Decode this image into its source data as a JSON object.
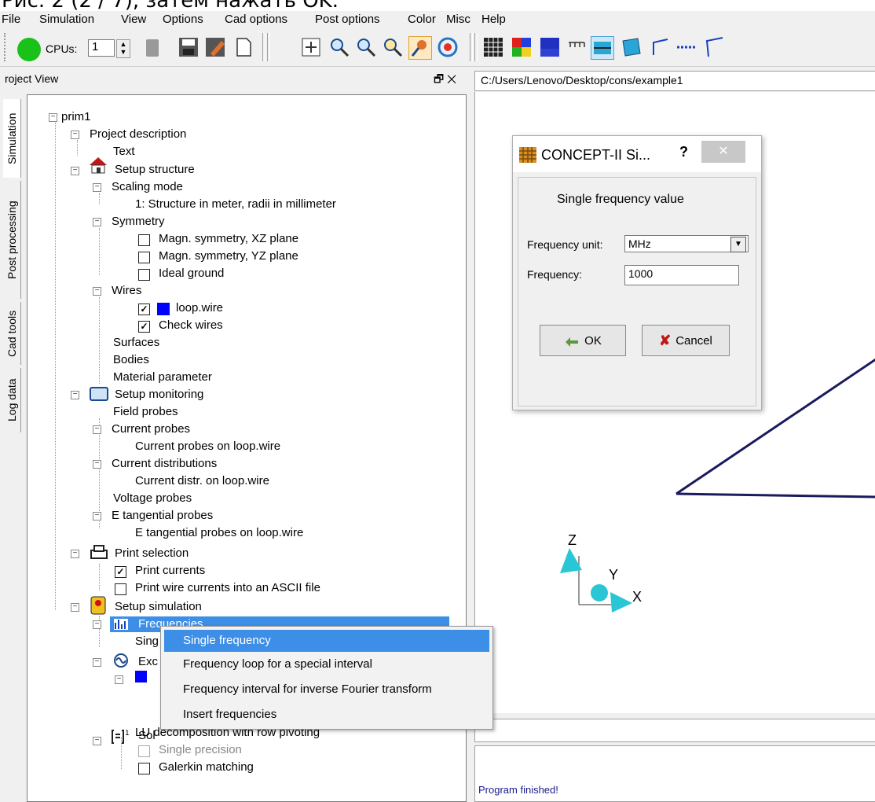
{
  "banner": {
    "text": "Рис. 2 (2 / 7), затем нажать OK."
  },
  "menubar": {
    "items": [
      "File",
      "Simulation",
      "View",
      "Options",
      "Cad options",
      "Post options",
      "Color",
      "Misc",
      "Help"
    ]
  },
  "toolbar": {
    "cpus_label": "CPUs:",
    "cpus_value": "1"
  },
  "project_view": {
    "title": "roject View",
    "pin": "🗗 ✕"
  },
  "side_tabs": [
    "Simulation",
    "Post processing",
    "Cad tools",
    "Log data"
  ],
  "tree": {
    "root": "prim1",
    "project_description": "Project description",
    "text": "Text",
    "setup_structure": "Setup structure",
    "scaling_mode": "Scaling mode",
    "scaling_value": "1: Structure in meter, radii in millimeter",
    "symmetry": "Symmetry",
    "sym_xz": "Magn. symmetry, XZ plane",
    "sym_yz": "Magn. symmetry, YZ plane",
    "ideal_ground": "Ideal ground",
    "wires": "Wires",
    "loop_wire": "loop.wire",
    "check_wires": "Check wires",
    "surfaces": "Surfaces",
    "bodies": "Bodies",
    "material": "Material parameter",
    "setup_monitoring": "Setup monitoring",
    "field_probes": "Field probes",
    "current_probes": "Current probes",
    "current_probes_loop": "Current probes on loop.wire",
    "current_distributions": "Current distributions",
    "current_distr_loop": "Current distr. on loop.wire",
    "voltage_probes": "Voltage probes",
    "e_tangential": "E tangential probes",
    "e_tangential_loop": "E tangential probes on loop.wire",
    "print_selection": "Print selection",
    "print_currents": "Print currents",
    "print_ascii": "Print wire currents into an ASCII file",
    "setup_simulation": "Setup simulation",
    "frequencies": "Frequencies",
    "single_partial": "Sing",
    "exc_partial": "Exc",
    "solver_partial": "Sol",
    "lu": "LU decomposition with row pivoting",
    "single_precision": "Single precision",
    "galerkin": "Galerkin matching"
  },
  "path": "C:/Users/Lenovo/Desktop/cons/example1",
  "dialog": {
    "title": "CONCEPT-II Si...",
    "help": "?",
    "close": "✕",
    "heading": "Single frequency value",
    "unit_label": "Frequency unit:",
    "unit_value": "MHz",
    "freq_label": "Frequency:",
    "freq_value": "1000",
    "ok": "OK",
    "cancel": "Cancel"
  },
  "context_menu": {
    "items": [
      "Single frequency",
      "Frequency loop for a special interval",
      "Frequency interval for inverse Fourier transform",
      "Insert frequencies"
    ]
  },
  "axes": {
    "z": "Z",
    "y": "Y",
    "x": "X"
  },
  "log": {
    "message": "Program finished!"
  },
  "colors": {
    "accent": "#3d8ee6",
    "wire": "#0000ff",
    "geometry": "#1a1a5e",
    "axis_cone": "#29c6d6"
  }
}
